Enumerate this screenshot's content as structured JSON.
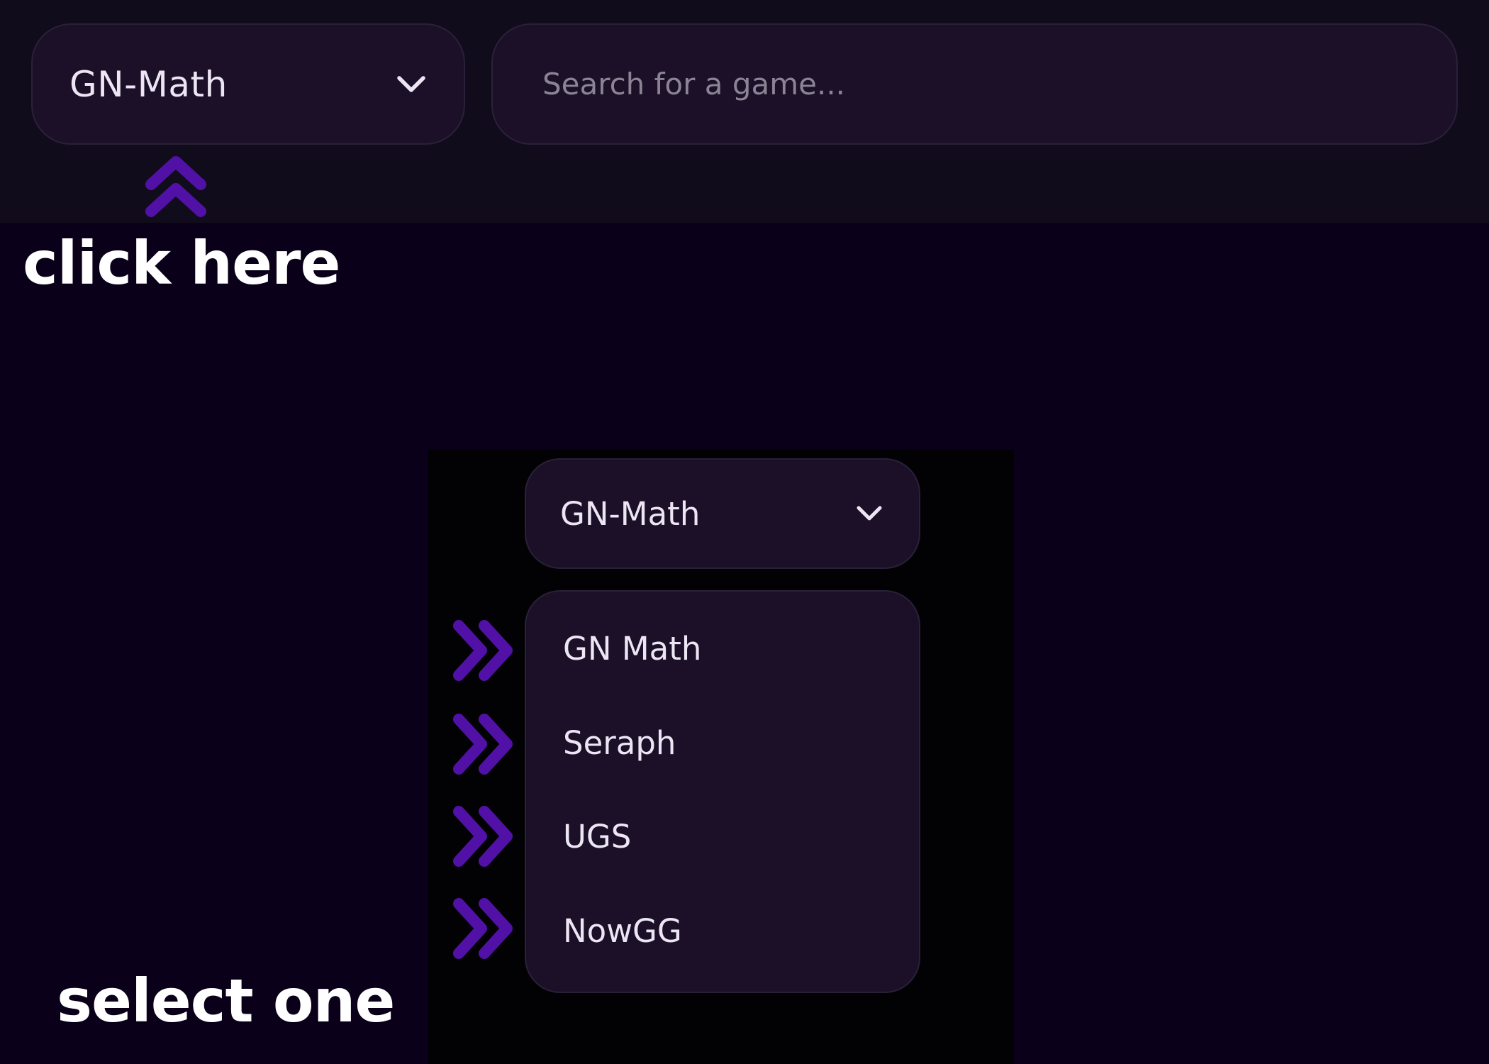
{
  "header": {
    "source_select": {
      "value": "GN-Math",
      "icon": "chevron-down-icon"
    },
    "search": {
      "placeholder": "Search for a game..."
    }
  },
  "annotations": {
    "click_label": "click here",
    "select_label": "select one",
    "arrow_color": "#5211a6",
    "up_arrow_icon": "double-chevron-up-icon",
    "right_arrow_icon": "double-chevron-right-icon"
  },
  "inset": {
    "source_select": {
      "value": "GN-Math",
      "icon": "chevron-down-icon"
    },
    "options": [
      {
        "label": "GN Math"
      },
      {
        "label": "Seraph"
      },
      {
        "label": "UGS"
      },
      {
        "label": "NowGG"
      }
    ]
  },
  "colors": {
    "page_background": "#0b0019",
    "header_background": "#110c1c",
    "control_background": "#1b1027",
    "control_border": "#2a2038",
    "text": "#ece6f4",
    "placeholder": "#8a8494"
  }
}
